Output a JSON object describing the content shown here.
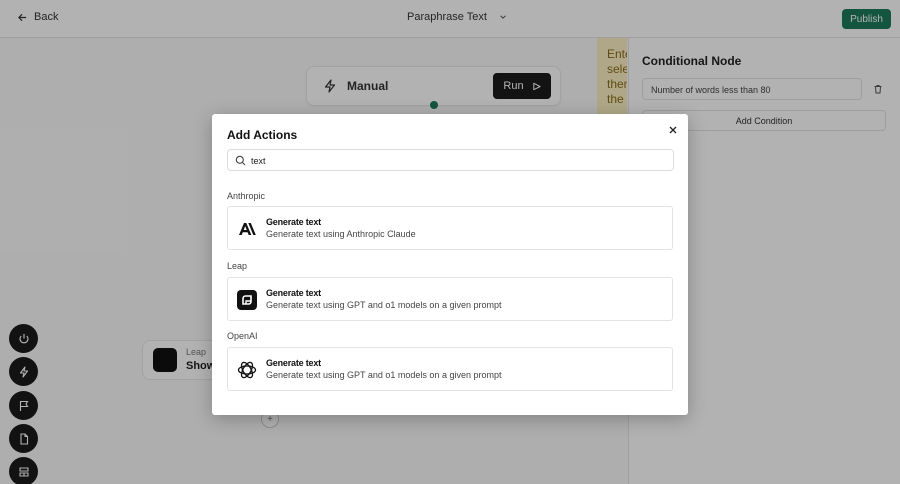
{
  "topbar": {
    "back_label": "Back",
    "title": "Paraphrase Text",
    "publish_label": "Publish"
  },
  "canvas": {
    "trigger_label": "Manual",
    "run_label": "Run",
    "note_lines": [
      "Ente",
      "sele",
      "then",
      "the t"
    ],
    "leap_node": {
      "provider": "Leap",
      "title": "Show"
    },
    "add_step_label": "+"
  },
  "side_panel": {
    "title": "Conditional Node",
    "condition_value": "Number of words less than 80",
    "add_condition_label": "Add Condition"
  },
  "toolbar": {
    "tools": [
      "power-icon",
      "bolt-icon",
      "flag-icon",
      "document-icon",
      "layout-icon"
    ]
  },
  "modal": {
    "title": "Add Actions",
    "search": {
      "value": "text"
    },
    "groups": [
      {
        "label": "Anthropic",
        "items": [
          {
            "name": "Generate text",
            "description": "Generate text using Anthropic Claude",
            "icon": "anthropic-logo-icon"
          }
        ]
      },
      {
        "label": "Leap",
        "items": [
          {
            "name": "Generate text",
            "description": "Generate text using GPT and o1 models on a given prompt",
            "icon": "leap-logo-icon"
          }
        ]
      },
      {
        "label": "OpenAI",
        "items": [
          {
            "name": "Generate text",
            "description": "Generate text using GPT and o1 models on a given prompt",
            "icon": "openai-logo-icon"
          }
        ]
      }
    ]
  },
  "colors": {
    "accent_green": "#1e7a5c",
    "dark": "#1a1a1a",
    "note_yellow": "#fbf0c2"
  }
}
